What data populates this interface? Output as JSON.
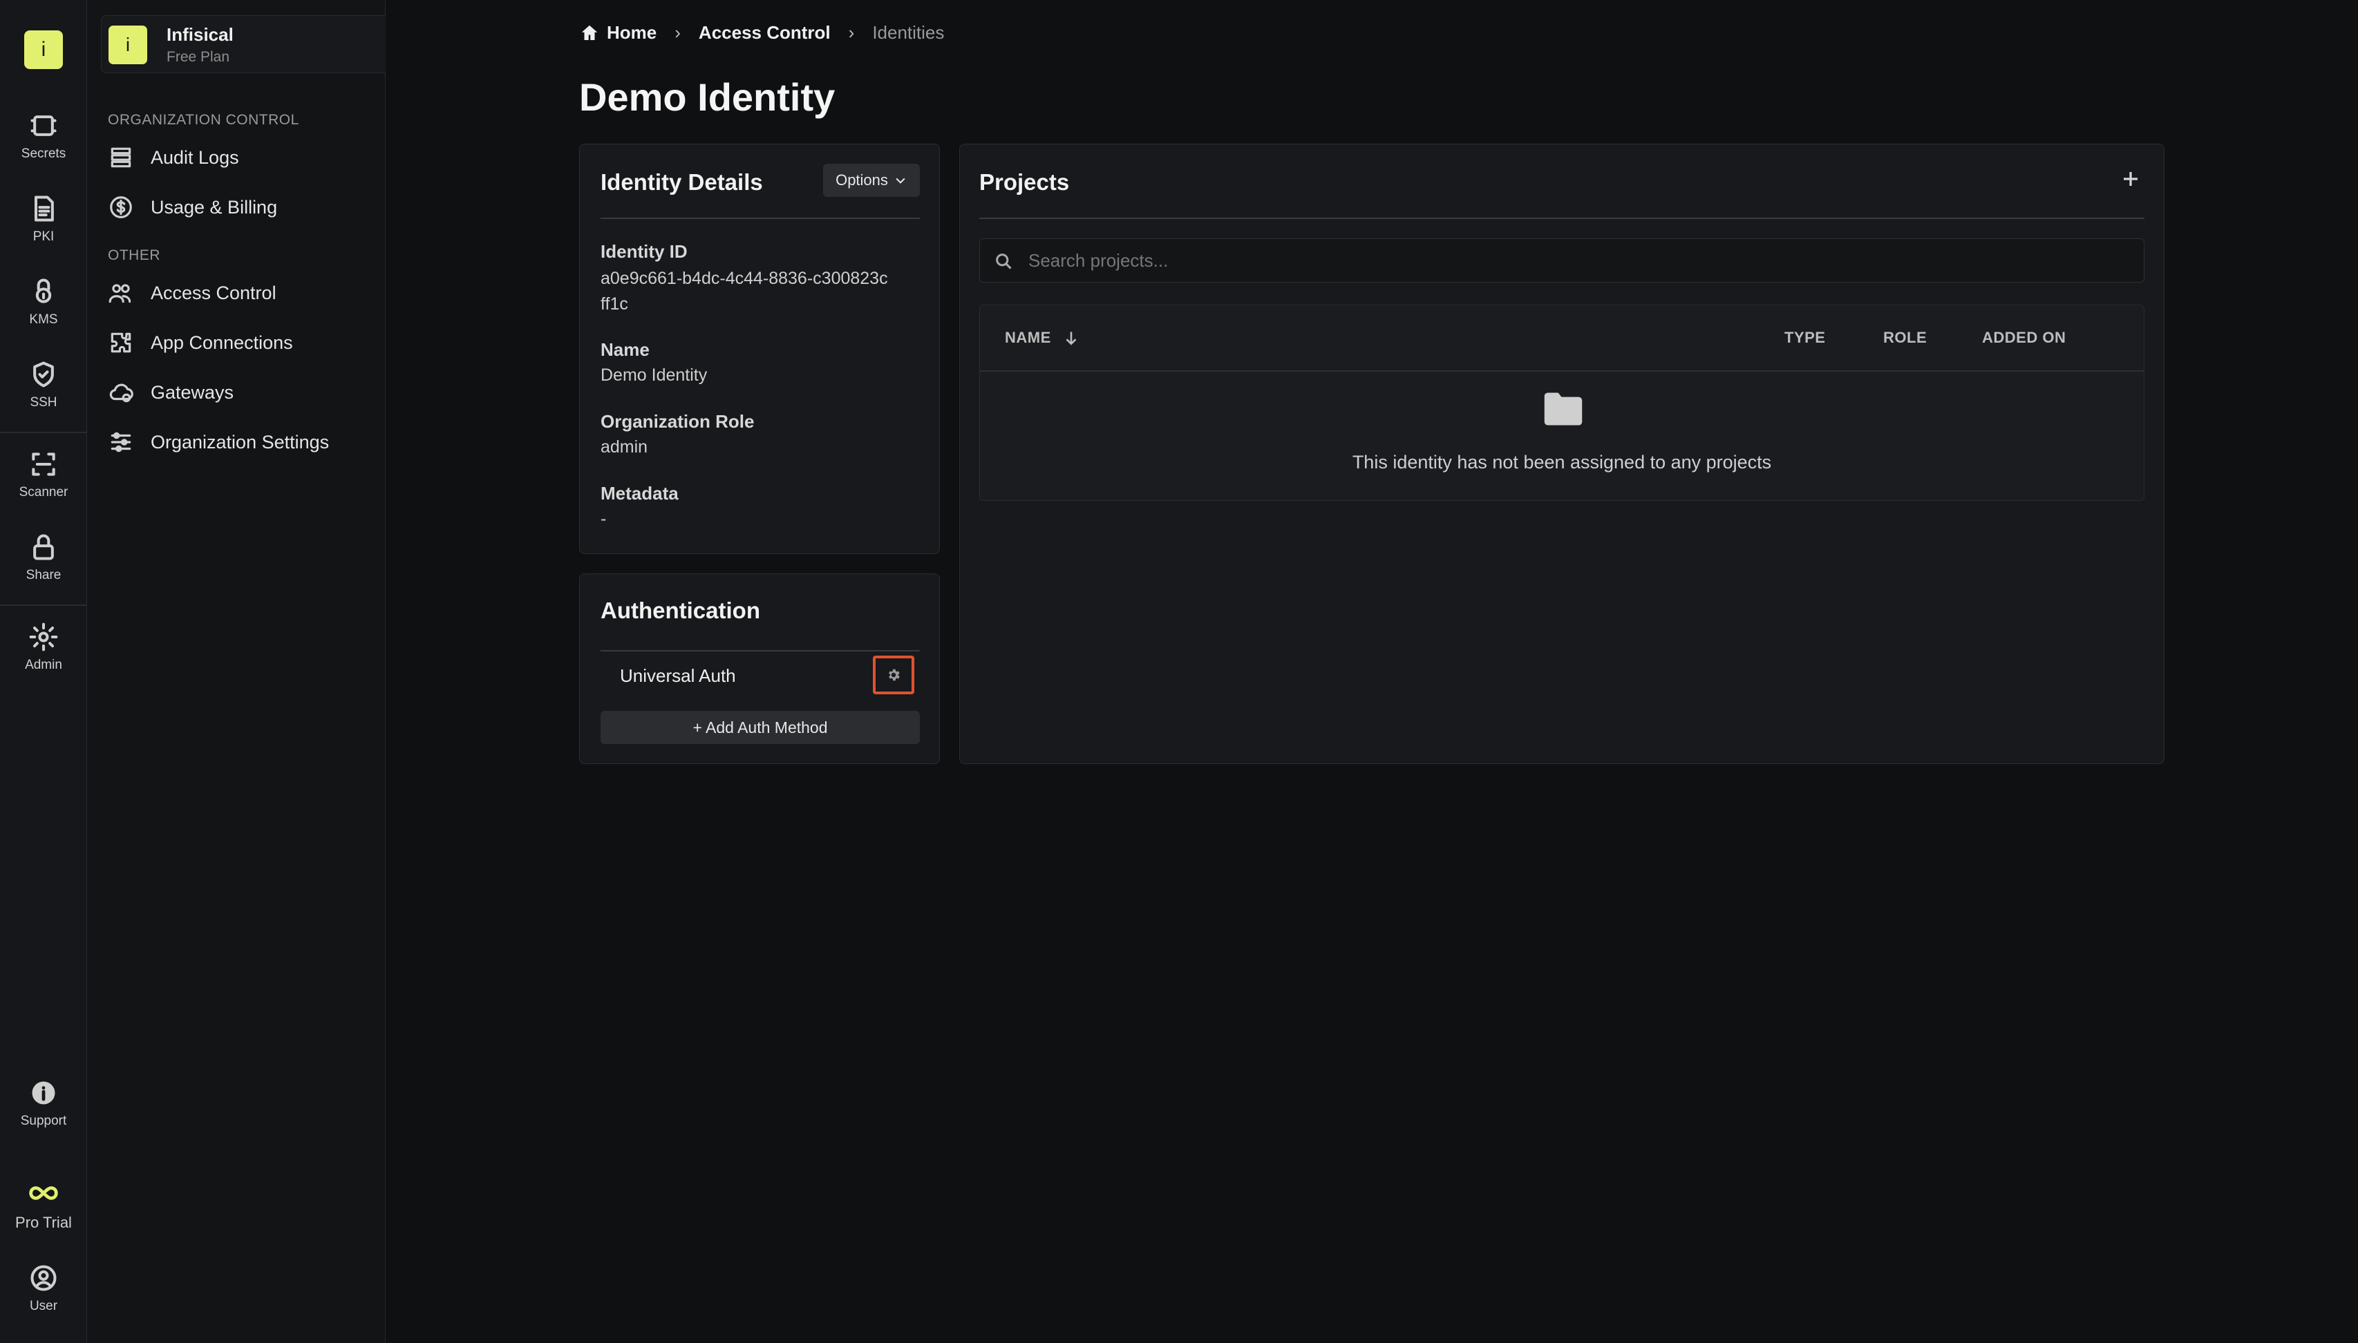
{
  "rail": {
    "logo": "i",
    "items": [
      {
        "label": "Secrets",
        "icon": "vault-icon"
      },
      {
        "label": "PKI",
        "icon": "document-icon"
      },
      {
        "label": "KMS",
        "icon": "key-lock-icon"
      },
      {
        "label": "SSH",
        "icon": "shield-check-icon"
      },
      {
        "label": "Scanner",
        "icon": "scan-icon"
      },
      {
        "label": "Share",
        "icon": "lock-icon"
      },
      {
        "label": "Admin",
        "icon": "gear-icon"
      },
      {
        "label": "Support",
        "icon": "info-icon"
      },
      {
        "label": "Pro Trial",
        "icon": "infinity-icon"
      },
      {
        "label": "User",
        "icon": "user-icon"
      }
    ]
  },
  "org": {
    "avatar": "i",
    "name": "Infisical",
    "plan": "Free Plan"
  },
  "sidenav": {
    "section_org": "ORGANIZATION CONTROL",
    "section_other": "OTHER",
    "items": [
      {
        "label": "Audit Logs",
        "icon": "stack-icon"
      },
      {
        "label": "Usage & Billing",
        "icon": "dollar-icon"
      },
      {
        "label": "Access Control",
        "icon": "users-icon"
      },
      {
        "label": "App Connections",
        "icon": "puzzle-icon"
      },
      {
        "label": "Gateways",
        "icon": "cloud-icon"
      },
      {
        "label": "Organization Settings",
        "icon": "sliders-icon"
      }
    ]
  },
  "breadcrumb": {
    "home": "Home",
    "section": "Access Control",
    "current": "Identities"
  },
  "page_title": "Demo Identity",
  "identity_details": {
    "title": "Identity Details",
    "options_label": "Options",
    "fields": [
      {
        "label": "Identity ID",
        "value": "a0e9c661-b4dc-4c44-8836-c300823cff1c"
      },
      {
        "label": "Name",
        "value": "Demo Identity"
      },
      {
        "label": "Organization Role",
        "value": "admin"
      },
      {
        "label": "Metadata",
        "value": "-"
      }
    ]
  },
  "authentication": {
    "title": "Authentication",
    "methods": [
      {
        "name": "Universal Auth"
      }
    ],
    "add_label": "+ Add Auth Method"
  },
  "projects": {
    "title": "Projects",
    "search_placeholder": "Search projects...",
    "columns": [
      "NAME",
      "TYPE",
      "ROLE",
      "ADDED ON"
    ],
    "empty_message": "This identity has not been assigned to any projects"
  },
  "colors": {
    "accent": "#e2f06f",
    "highlight": "#e0522f",
    "background": "#0f1012",
    "card": "#18191c"
  }
}
